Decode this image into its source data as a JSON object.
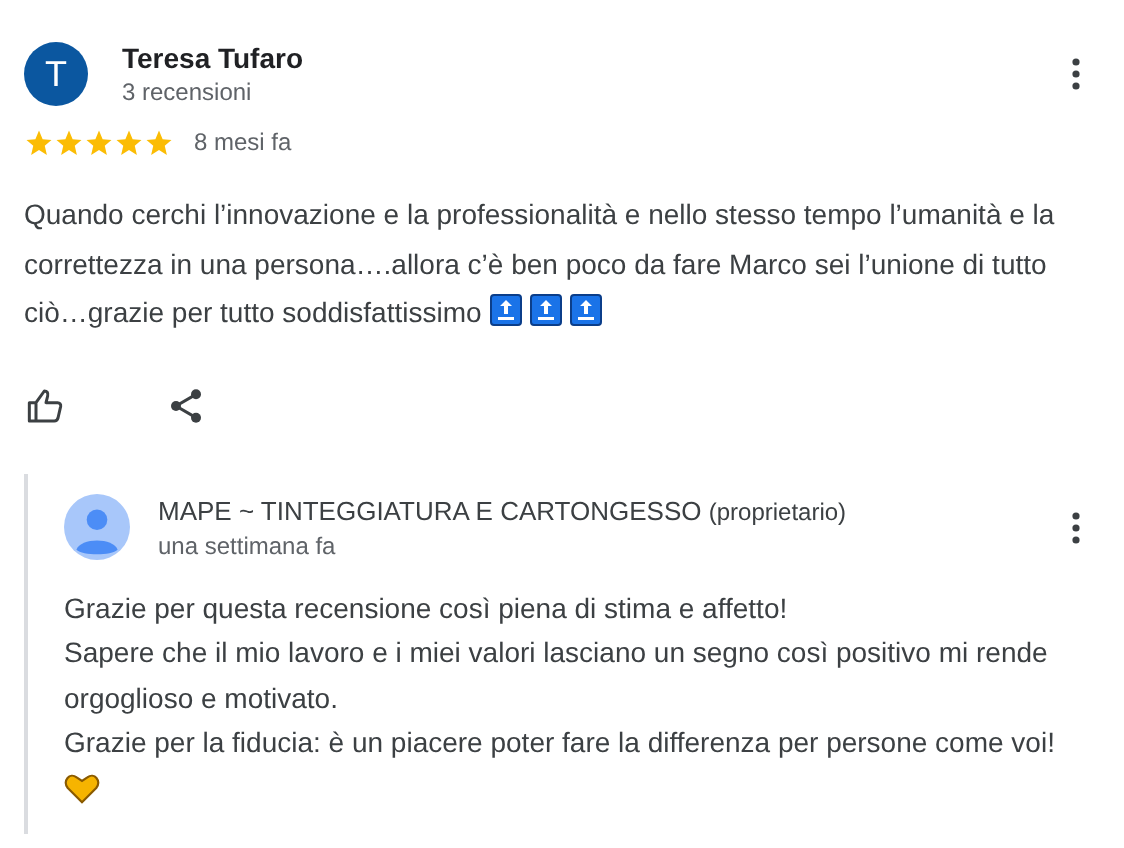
{
  "review": {
    "author": "Teresa Tufaro",
    "initial": "T",
    "reviews_count": "3 recensioni",
    "stars": 5,
    "time": "8 mesi fa",
    "text": "Quando cerchi l’innovazione e la professionalità e nello stesso tempo l’umanità e la correttezza in una persona….allora c’è ben poco da fare Marco sei l’unione di tutto ciò…grazie per tutto soddisfattissimo"
  },
  "reply": {
    "author": "MAPE ~ TINTEGGIATURA E CARTONGESSO",
    "role": "(proprietario)",
    "time": "una settimana fa",
    "lines": [
      "Grazie per questa recensione così piena di stima e affetto!",
      "Sapere che il mio lavoro e i miei valori lasciano un segno così positivo mi rende orgoglioso e motivato.",
      "Grazie per la fiducia: è un piacere poter fare la differenza per persone come voi!"
    ]
  }
}
